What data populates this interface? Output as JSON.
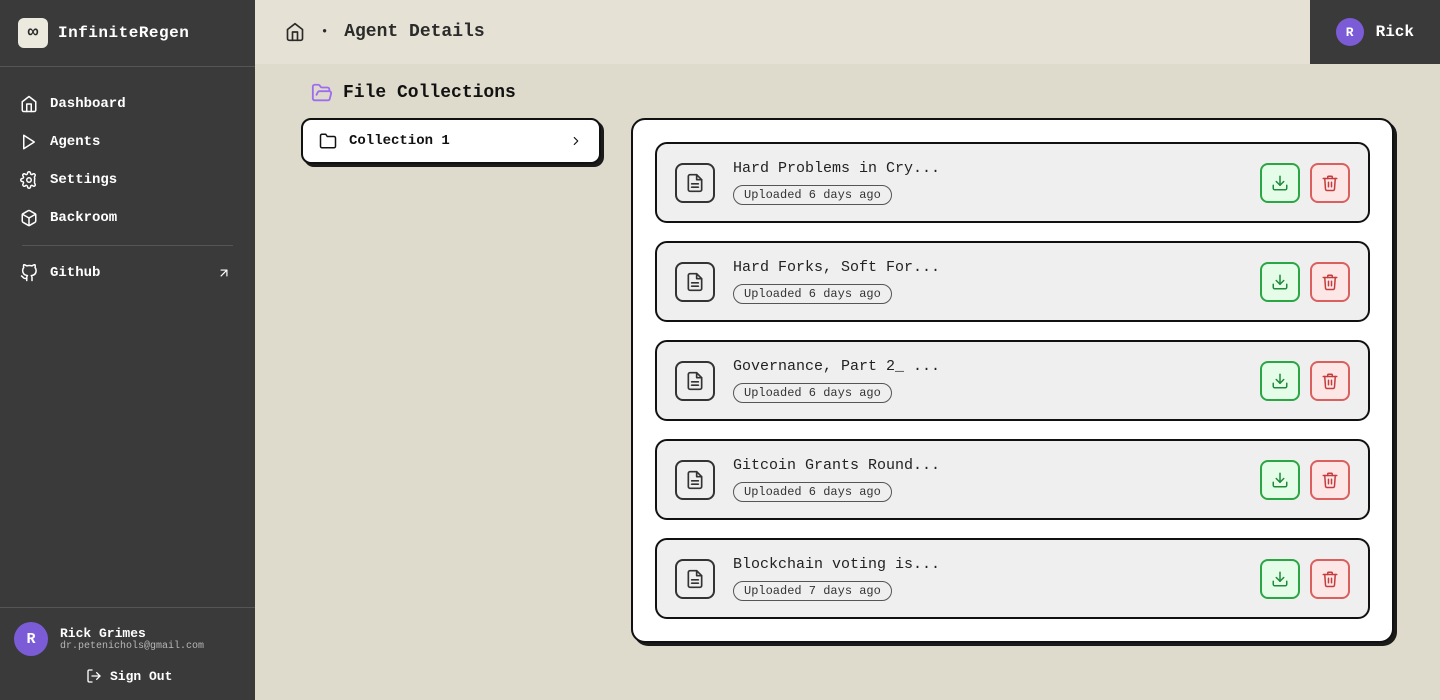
{
  "app": {
    "name": "InfiniteRegen",
    "logo_glyph": "∞"
  },
  "sidebar": {
    "items": [
      {
        "label": "Dashboard",
        "icon": "home-icon"
      },
      {
        "label": "Agents",
        "icon": "play-icon"
      },
      {
        "label": "Settings",
        "icon": "gear-icon"
      },
      {
        "label": "Backroom",
        "icon": "box-icon"
      }
    ],
    "external": {
      "label": "Github",
      "icon": "github-icon"
    }
  },
  "breadcrumb": {
    "page_title": "Agent Details"
  },
  "user": {
    "short": "Rick",
    "initial": "R",
    "full_name": "Rick Grimes",
    "email": "dr.petenichols@gmail.com",
    "signout_label": "Sign Out"
  },
  "section": {
    "title": "File Collections"
  },
  "collections": [
    {
      "name": "Collection 1"
    }
  ],
  "files": [
    {
      "name": "Hard Problems in Cry...",
      "uploaded": "Uploaded 6 days ago"
    },
    {
      "name": "Hard Forks, Soft For...",
      "uploaded": "Uploaded 6 days ago"
    },
    {
      "name": "Governance, Part 2_ ...",
      "uploaded": "Uploaded 6 days ago"
    },
    {
      "name": "Gitcoin Grants Round...",
      "uploaded": "Uploaded 6 days ago"
    },
    {
      "name": "Blockchain voting is...",
      "uploaded": "Uploaded 7 days ago"
    }
  ]
}
